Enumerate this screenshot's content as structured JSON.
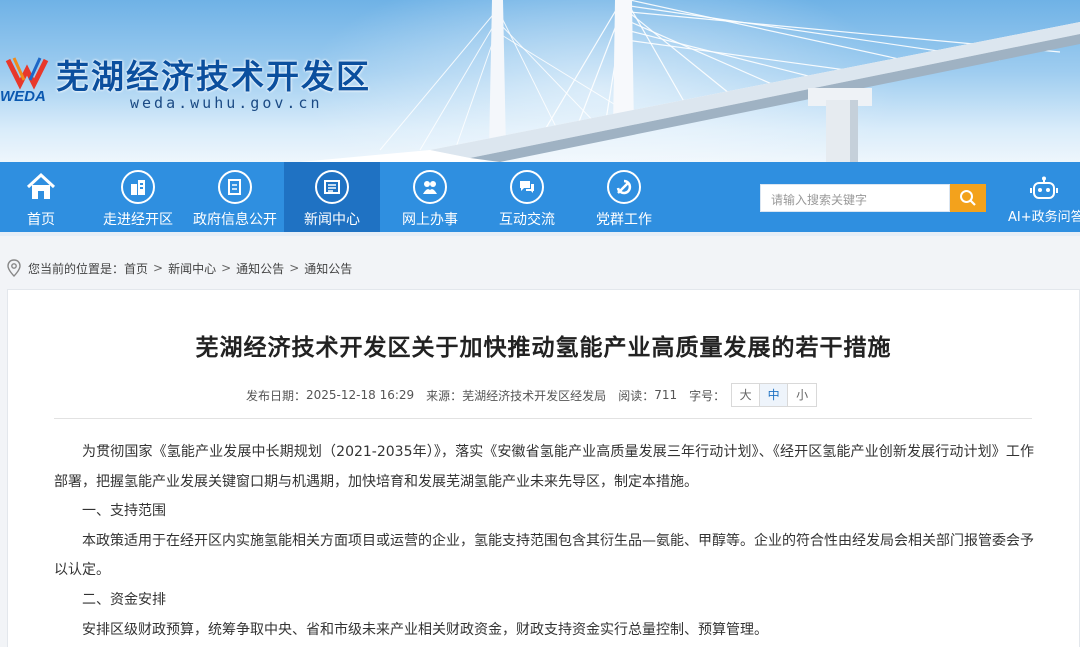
{
  "header": {
    "site_name": "芜湖经济技术开发区",
    "site_url": "weda.wuhu.gov.cn",
    "logo_text": "WEDA"
  },
  "nav": {
    "items": [
      {
        "label": "首页",
        "icon": "home-icon"
      },
      {
        "label": "走进经开区",
        "icon": "buildings-icon"
      },
      {
        "label": "政府信息公开",
        "icon": "document-icon"
      },
      {
        "label": "新闻中心",
        "icon": "newspaper-icon",
        "active": true
      },
      {
        "label": "网上办事",
        "icon": "handshake-icon"
      },
      {
        "label": "互动交流",
        "icon": "chat-icon"
      },
      {
        "label": "党群工作",
        "icon": "party-emblem-icon"
      }
    ],
    "search_placeholder": "请输入搜索关键字",
    "ai_label": "AI+政务问答",
    "colors": {
      "bar": "#2f8fe0",
      "active": "#1f72c3",
      "search_button": "#f3a21c"
    }
  },
  "breadcrumb": {
    "prefix": "您当前的位置是：",
    "items": [
      "首页",
      "新闻中心",
      "通知公告",
      "通知公告"
    ]
  },
  "article": {
    "title": "芜湖经济技术开发区关于加快推动氢能产业高质量发展的若干措施",
    "meta": {
      "date_label": "发布日期：",
      "date": "2025-12-18 16:29",
      "source_label": "来源：",
      "source": "芜湖经济技术开发区经发局",
      "views_label": "阅读：",
      "views": "711",
      "font_label": "字号：",
      "font_sizes": [
        "大",
        "中",
        "小"
      ]
    },
    "paragraphs": [
      "为贯彻国家《氢能产业发展中长期规划（2021-2035年）》，落实《安徽省氢能产业高质量发展三年行动计划》、《经开区氢能产业创新发展行动计划》工作部署，把握氢能产业发展关键窗口期与机遇期，加快培育和发展芜湖氢能产业未来先导区，制定本措施。",
      "一、支持范围",
      "本政策适用于在经开区内实施氢能相关方面项目或运营的企业，氢能支持范围包含其衍生品—氨能、甲醇等。企业的符合性由经发局会相关部门报管委会予以认定。",
      "二、资金安排",
      "安排区级财政预算，统筹争取中央、省和市级未来产业相关财政资金，财政支持资金实行总量控制、预算管理。"
    ]
  }
}
